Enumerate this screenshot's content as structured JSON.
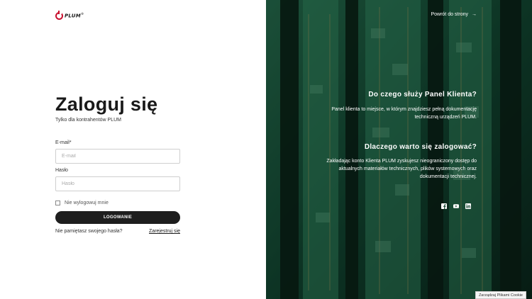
{
  "brand": {
    "logo_text": "PLUM",
    "logo_tm": "®"
  },
  "login": {
    "title": "Zaloguj się",
    "subtitle": "Tylko dla kontrahentów PLUM",
    "email_label": "E-mail*",
    "email_placeholder": "E-mail",
    "email_value": "",
    "password_label": "Hasło",
    "password_placeholder": "Hasło",
    "password_value": "",
    "remember_label": "Nie wylogowuj mnie",
    "remember_checked": false,
    "login_button": "LOGOWANIE",
    "forgot_text": "Nie pamiętasz swojego hasła?",
    "register_link": "Zarejestruj się"
  },
  "info": {
    "back_link": "Powrót do strony",
    "back_icon": "arrow-right-icon",
    "heading_1": "Do czego służy Panel Klienta?",
    "text_1": "Panel klienta to miejsce, w którym znajdziesz pełną dokumentację techniczną urządzeń PLUM.",
    "heading_2": "Dlaczego warto się zalogować?",
    "text_2": "Zakładając konto Klienta PLUM zyskujesz nieograniczony dostęp do aktualnych materiałów technicznych, plików systemowych oraz dokumentacji technicznej.",
    "socials": [
      "facebook-icon",
      "youtube-icon",
      "linkedin-icon"
    ]
  },
  "cookie": {
    "label": "Zarządzaj Plikami Cookie"
  },
  "colors": {
    "accent": "#c8102e",
    "button_bg": "#1e1e1e",
    "panel_bg": "#1d5c43"
  }
}
